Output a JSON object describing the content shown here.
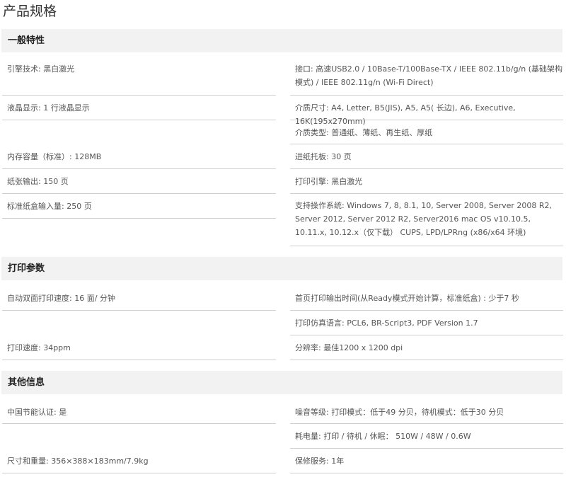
{
  "page_title": "产品规格",
  "sections": [
    {
      "title": "一般特性",
      "left": [
        "引擎技术: 黑白激光",
        "液晶显示: 1 行液晶显示",
        "内存容量（标准）: 128MB",
        "纸张输出: 150 页",
        "标准纸盒输入量: 250 页"
      ],
      "right": [
        "接口: 高速USB2.0 / 10Base-T/100Base-TX / IEEE 802.11b/g/n (基础架构模式) / IEEE 802.11g/n (Wi-Fi Direct)",
        "介质尺寸: A4, Letter, B5(JIS), A5, A5( 长边), A6, Executive, 16K(195x270mm)",
        "介质类型: 普通纸、薄纸、再生纸、厚纸",
        "进纸托板: 30 页",
        "打印引擎: 黑白激光",
        "支持操作系统: Windows 7, 8, 8.1, 10, Server 2008, Server 2008 R2, Server 2012, Server 2012 R2, Server2016 mac OS v10.10.5, 10.11.x, 10.12.x（仅下载） CUPS, LPD/LPRng (x86/x64 环境)"
      ]
    },
    {
      "title": "打印参数",
      "left": [
        "自动双面打印速度: 16 面/ 分钟",
        "打印速度: 34ppm"
      ],
      "right": [
        "首页打印输出时间(从Ready模式开始计算，标准纸盒) : 少于7 秒",
        "打印仿真语言: PCL6, BR-Script3, PDF Version 1.7",
        "分辨率: 最佳1200 x 1200 dpi"
      ]
    },
    {
      "title": "其他信息",
      "left": [
        "中国节能认证: 是",
        "尺寸和重量: 356×388×183mm/7.9kg"
      ],
      "right": [
        "噪音等级: 打印模式：低于49 分贝，待机模式：低于30 分贝",
        "耗电量: 打印 / 待机 / 休眠： 510W / 48W / 0.6W",
        "保修服务: 1年"
      ]
    }
  ]
}
